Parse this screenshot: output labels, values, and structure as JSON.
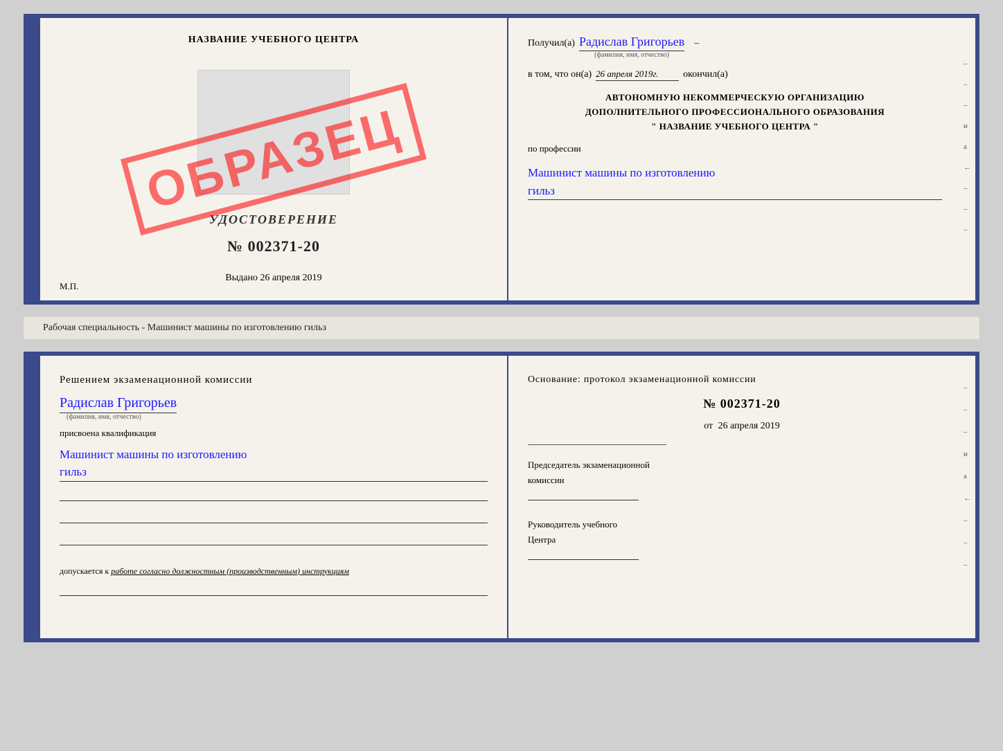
{
  "top": {
    "left": {
      "org_name": "НАЗВАНИЕ УЧЕБНОГО ЦЕНТРА",
      "udostoverenie_label": "УДОСТОВЕРЕНИЕ",
      "number": "№ 002371-20",
      "vydano_label": "Выдано",
      "vydano_date": "26 апреля 2019",
      "mp_label": "М.П.",
      "obrazets": "ОБРАЗЕЦ"
    },
    "right": {
      "poluchil_label": "Получил(а)",
      "poluchil_name": "Радислав Григорьев",
      "fio_hint": "(фамилия, имя, отчество)",
      "vtom_label": "в том, что он(а)",
      "date_value": "26 апреля 2019г.",
      "okonchil_label": "окончил(а)",
      "org_line1": "АВТОНОМНУЮ НЕКОММЕРЧЕСКУЮ ОРГАНИЗАЦИЮ",
      "org_line2": "ДОПОЛНИТЕЛЬНОГО ПРОФЕССИОНАЛЬНОГО ОБРАЗОВАНИЯ",
      "org_line3": "\"   НАЗВАНИЕ УЧЕБНОГО ЦЕНТРА   \"",
      "po_professii_label": "по профессии",
      "profession_text": "Машинист машины по изготовлению",
      "profession_text2": "гильз",
      "side_marks": [
        "-",
        "-",
        "-",
        "и",
        "а",
        "←",
        "-",
        "-",
        "-"
      ]
    }
  },
  "spacer": {
    "text": "Рабочая специальность - Машинист машины по изготовлению гильз"
  },
  "bottom": {
    "left": {
      "resheniem_label": "Решением  экзаменационной  комиссии",
      "name_cursive": "Радислав Григорьев",
      "fio_hint": "(фамилия, имя, отчество)",
      "prisvоena_label": "присвоена квалификация",
      "kvalif_text": "Машинист машины по изготовлению",
      "kvalif_text2": "гильз",
      "dopuskaetsya_prefix": "допускается к",
      "dopuskaetsya_text": "работе согласно должностным (производственным) инструкциям"
    },
    "right": {
      "osnovanie_label": "Основание: протокол экзаменационной  комиссии",
      "protocol_number": "№  002371-20",
      "ot_label": "от",
      "ot_date": "26 апреля 2019",
      "chairman_label": "Председатель экзаменационной",
      "chairman_label2": "комиссии",
      "rukovod_label": "Руководитель учебного",
      "rukovod_label2": "Центра",
      "side_marks": [
        "-",
        "-",
        "-",
        "и",
        "а",
        "←",
        "-",
        "-",
        "-"
      ]
    }
  }
}
